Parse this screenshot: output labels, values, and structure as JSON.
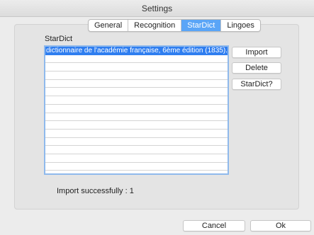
{
  "window": {
    "title": "Settings"
  },
  "tabs": [
    {
      "label": "General",
      "active": false
    },
    {
      "label": "Recognition",
      "active": false
    },
    {
      "label": "StarDict",
      "active": true
    },
    {
      "label": "Lingoes",
      "active": false
    }
  ],
  "stardict": {
    "section_label": "StarDict",
    "dictionaries": [
      "dictionnaire de l'académie française, 6ème édition (1835)."
    ],
    "import_label": "Import",
    "delete_label": "Delete",
    "help_label": "StarDict?",
    "status_text": "Import successfully : 1"
  },
  "footer": {
    "cancel_label": "Cancel",
    "ok_label": "Ok"
  },
  "colors": {
    "accent": "#5aa5f7",
    "selection": "#2f7ef0",
    "list_border": "#8fb9ec"
  }
}
